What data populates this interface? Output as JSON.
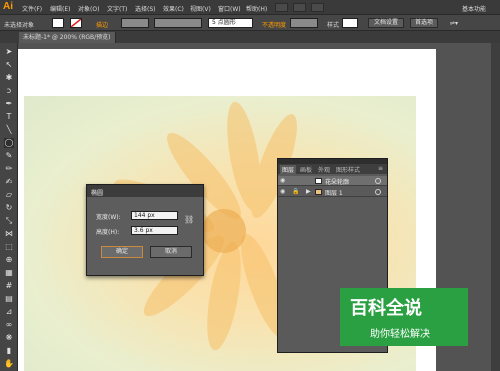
{
  "app": {
    "logo": "Ai",
    "menu": [
      "文件(F)",
      "编辑(E)",
      "对象(O)",
      "文字(T)",
      "选择(S)",
      "效果(C)",
      "视图(V)",
      "窗口(W)",
      "帮助(H)"
    ],
    "workspace_label": "基本功能"
  },
  "controlbar": {
    "no_selection": "未选择对象",
    "stroke_label": "描边",
    "brush_value": "5 点圆形",
    "opacity_label": "不透明度",
    "style_label": "样式",
    "doc_setup": "文档设置",
    "prefs": "首选项"
  },
  "tab": {
    "label": "未标题-1* @ 200% (RGB/预览)"
  },
  "dialog": {
    "title": "椭圆",
    "width_label": "宽度(W):",
    "width_value": "144 px",
    "height_label": "高度(H):",
    "height_value": "3.6 px",
    "ok": "确定",
    "cancel": "取消"
  },
  "layers": {
    "tabs": [
      "图层",
      "画板",
      "外观",
      "图形样式"
    ],
    "rows": [
      {
        "name": "花朵轮廓"
      },
      {
        "name": "图层 1"
      }
    ]
  },
  "watermark": {
    "title": "百科全说",
    "subtitle": "助你轻松解决"
  },
  "colors": {
    "accent": "#ff9a00",
    "watermark_green": "#2aa043"
  }
}
